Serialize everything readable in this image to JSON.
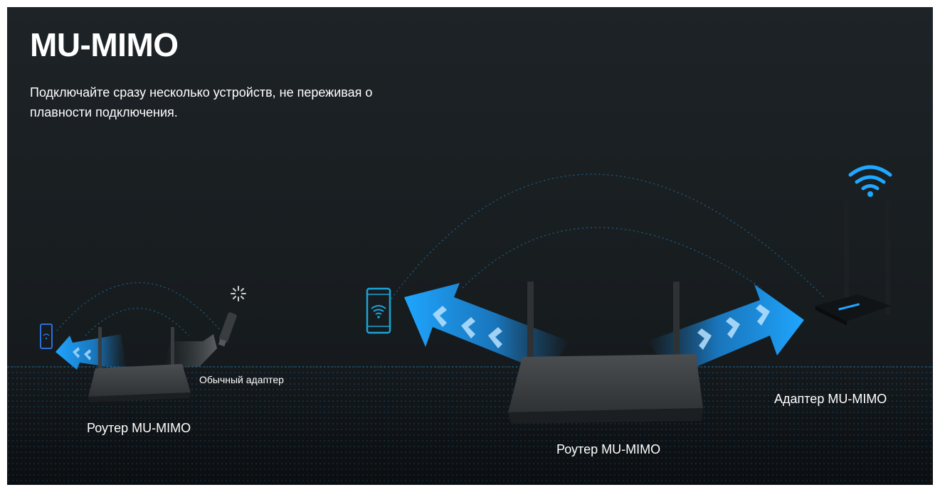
{
  "header": {
    "title": "MU-MIMO",
    "subtitle": "Подключайте сразу несколько устройств, не переживая о плавности подключения."
  },
  "labels": {
    "left_router": "Роутер MU-MIMO",
    "left_adapter": "Обычный адаптер",
    "center_router": "Роутер MU-MIMO",
    "right_adapter": "Адаптер MU-MIMO"
  },
  "colors": {
    "accent": "#1e9cf0",
    "background": "#1a1f22",
    "text": "#ffffff"
  },
  "icons": [
    "wifi-icon",
    "phone-icon",
    "loading-spinner-icon",
    "usb-adapter-icon"
  ]
}
